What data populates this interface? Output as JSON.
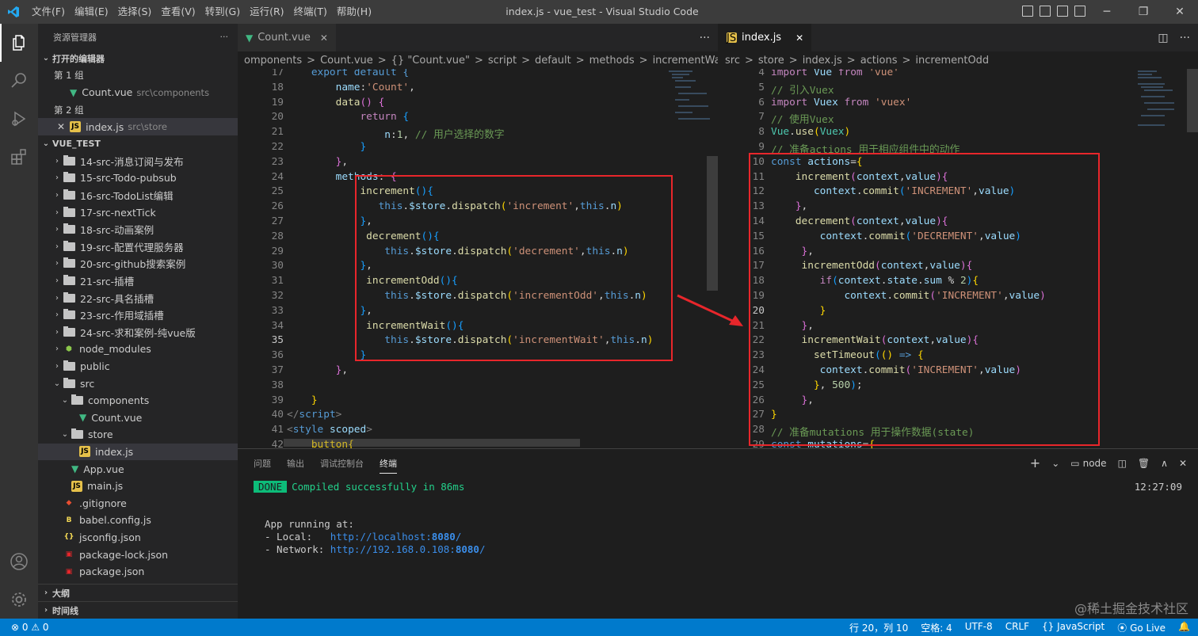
{
  "window": {
    "title": "index.js - vue_test - Visual Studio Code",
    "menu": [
      "文件(F)",
      "编辑(E)",
      "选择(S)",
      "查看(V)",
      "转到(G)",
      "运行(R)",
      "终端(T)",
      "帮助(H)"
    ]
  },
  "sidebar": {
    "title": "资源管理器",
    "open_editors": "打开的编辑器",
    "group1": "第 1 组",
    "group1_file": "Count.vue",
    "group1_path": "src\\components",
    "group2": "第 2 组",
    "group2_file": "index.js",
    "group2_path": "src\\store",
    "project": "VUE_TEST",
    "tree": [
      "14-src-消息订阅与发布",
      "15-src-Todo-pubsub",
      "16-src-TodoList编辑",
      "17-src-nextTick",
      "18-src-动画案例",
      "19-src-配置代理服务器",
      "20-src-github搜索案例",
      "21-src-插槽",
      "22-src-具名插槽",
      "23-src-作用域插槽",
      "24-src-求和案例-纯vue版",
      "node_modules",
      "public",
      "src",
      "components",
      "Count.vue",
      "store",
      "index.js",
      "App.vue",
      "main.js",
      ".gitignore",
      "babel.config.js",
      "jsconfig.json",
      "package-lock.json",
      "package.json"
    ],
    "outline": "大纲",
    "timeline": "时间线"
  },
  "editor1": {
    "tab": "Count.vue",
    "breadcrumb": [
      "omponents",
      ">",
      "Count.vue",
      ">",
      "{} \"Count.vue\"",
      ">",
      "script",
      ">",
      "default",
      ">",
      "methods",
      ">",
      "incrementWait"
    ]
  },
  "editor2": {
    "tab": "index.js",
    "breadcrumb": [
      "src",
      ">",
      "store",
      ">",
      "index.js",
      ">",
      "actions",
      ">",
      "incrementOdd"
    ]
  },
  "panel": {
    "tabs": [
      "问题",
      "输出",
      "调试控制台",
      "终端"
    ],
    "shell": "node",
    "done": "DONE",
    "compiled": "Compiled successfully in 86ms",
    "time": "12:27:09",
    "running": "App running at:",
    "local_label": "- Local:   ",
    "local_url": "http://localhost:",
    "local_port": "8080",
    "net_label": "- Network: ",
    "net_url": "http://192.168.0.108:",
    "net_port": "8080"
  },
  "status": {
    "problems": "⊗ 0 ⚠ 0",
    "position": "行 20，列 10",
    "spaces": "空格: 4",
    "encoding": "UTF-8",
    "eol": "CRLF",
    "lang": "{} JavaScript",
    "golive": "Go Live",
    "watermark": "@稀土掘金技术社区"
  },
  "colors": {
    "accent": "#007acc",
    "highlight": "#e8262b"
  }
}
